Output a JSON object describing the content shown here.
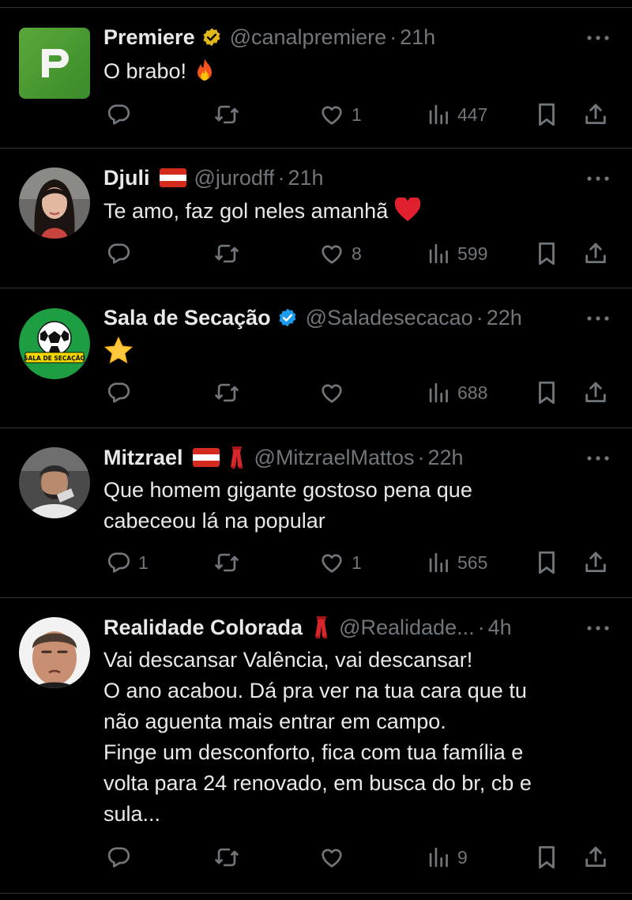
{
  "tweets": [
    {
      "name": "Premiere",
      "handle": "@canalpremiere",
      "dot": "·",
      "time": "21h",
      "text": "O brabo!",
      "avatar_icon": "premiere-logo",
      "badge": "gold-verified-badge",
      "flags": [],
      "reply_count": "",
      "retweet_count": "",
      "like_count": "1",
      "views_count": "447"
    },
    {
      "name": "Djuli",
      "handle": "@jurodff",
      "dot": "·",
      "time": "21h",
      "text": "Te amo, faz gol neles amanhã",
      "avatar_icon": "woman-photo",
      "badge": "",
      "flags": [
        "red-white-flag"
      ],
      "reply_count": "",
      "retweet_count": "",
      "like_count": "8",
      "views_count": "599"
    },
    {
      "name": "Sala de Secação",
      "handle": "@Saladesecacao",
      "dot": "·",
      "time": "22h",
      "text": "",
      "avatar_icon": "soccer-ball-logo",
      "avatar_label": "SALA DE SECAÇÃO",
      "badge": "blue-verified-badge",
      "flags": [],
      "reply_count": "",
      "retweet_count": "",
      "like_count": "",
      "views_count": "688"
    },
    {
      "name": "Mitzrael",
      "handle": "@MitzraelMattos",
      "dot": "·",
      "time": "22h",
      "text": "Que homem gigante gostoso pena que\ncabeceou lá na popular",
      "avatar_icon": "man-photo",
      "badge": "",
      "flags": [
        "red-white-flag",
        "scarf-emoji"
      ],
      "reply_count": "1",
      "retweet_count": "",
      "like_count": "1",
      "views_count": "565"
    },
    {
      "name": "Realidade Colorada",
      "handle": "@Realidade...",
      "dot": "·",
      "time": "4h",
      "text": "Vai descansar Valência, vai descansar!\nO ano acabou. Dá pra ver na tua cara que tu\nnão aguenta mais entrar em campo.\nFinge um desconforto, fica com tua família e\nvolta para 24 renovado, em busca do br, cb e\nsula...",
      "avatar_icon": "man-face-photo",
      "badge": "",
      "flags": [
        "scarf-emoji"
      ],
      "reply_count": "",
      "retweet_count": "",
      "like_count": "",
      "views_count": "9"
    }
  ],
  "colors": {
    "background": "#000000",
    "text": "#e7e9ea",
    "muted": "#71767b",
    "divider": "#2f3336",
    "verified_blue": "#1d9bf0",
    "verified_gold": "#e2b719"
  }
}
